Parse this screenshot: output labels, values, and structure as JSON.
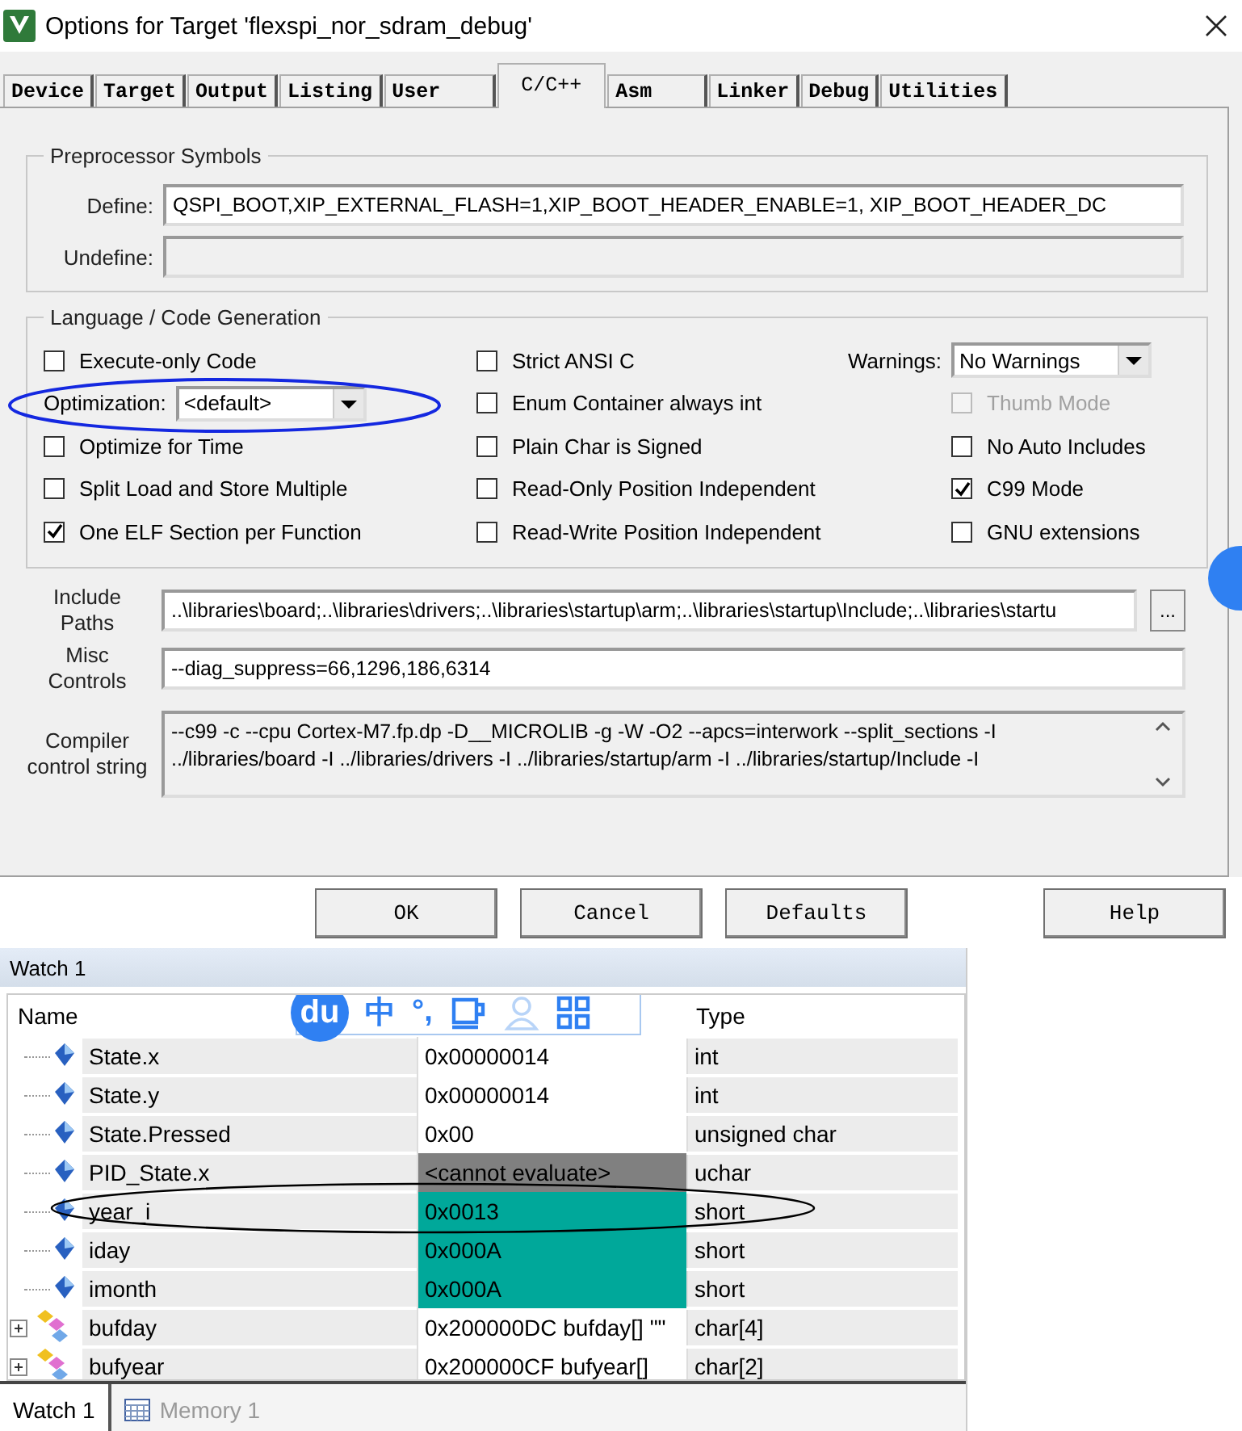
{
  "window": {
    "title": "Options for Target 'flexspi_nor_sdram_debug'"
  },
  "tabs": [
    {
      "label": "Device",
      "selected": false
    },
    {
      "label": "Target",
      "selected": false
    },
    {
      "label": "Output",
      "selected": false
    },
    {
      "label": "Listing",
      "selected": false
    },
    {
      "label": "User",
      "selected": false
    },
    {
      "label": "C/C++",
      "selected": true
    },
    {
      "label": "Asm",
      "selected": false
    },
    {
      "label": "Linker",
      "selected": false
    },
    {
      "label": "Debug",
      "selected": false
    },
    {
      "label": "Utilities",
      "selected": false
    }
  ],
  "preprocessor": {
    "title": "Preprocessor Symbols",
    "define_label": "Define:",
    "define_value": "QSPI_BOOT,XIP_EXTERNAL_FLASH=1,XIP_BOOT_HEADER_ENABLE=1, XIP_BOOT_HEADER_DC",
    "undefine_label": "Undefine:"
  },
  "code_generation": {
    "title": "Language / Code Generation",
    "columns": [
      [
        {
          "kind": "checkbox",
          "label": "Execute-only Code",
          "checked": false,
          "disabled": false
        },
        {
          "kind": "dropdown",
          "label": "Optimization:",
          "value": "<default>"
        },
        {
          "kind": "checkbox",
          "label": "Optimize for Time",
          "checked": false,
          "disabled": false
        },
        {
          "kind": "checkbox",
          "label": "Split Load and Store Multiple",
          "checked": false,
          "disabled": false
        },
        {
          "kind": "checkbox",
          "label": "One ELF Section per Function",
          "checked": true,
          "disabled": false
        }
      ],
      [
        {
          "kind": "checkbox",
          "label": "Strict ANSI C",
          "checked": false,
          "disabled": false
        },
        {
          "kind": "checkbox",
          "label": "Enum Container always int",
          "checked": false,
          "disabled": false
        },
        {
          "kind": "checkbox",
          "label": "Plain Char is Signed",
          "checked": false,
          "disabled": false
        },
        {
          "kind": "checkbox",
          "label": "Read-Only Position Independent",
          "checked": false,
          "disabled": false
        },
        {
          "kind": "checkbox",
          "label": "Read-Write Position Independent",
          "checked": false,
          "disabled": false
        }
      ],
      [
        {
          "kind": "dropdown",
          "label": "Warnings:",
          "value": "No Warnings"
        },
        {
          "kind": "checkbox",
          "label": "Thumb Mode",
          "checked": false,
          "disabled": true
        },
        {
          "kind": "checkbox",
          "label": "No Auto Includes",
          "checked": false,
          "disabled": false
        },
        {
          "kind": "checkbox",
          "label": "C99 Mode",
          "checked": true,
          "disabled": false
        },
        {
          "kind": "checkbox",
          "label": "GNU extensions",
          "checked": false,
          "disabled": false
        }
      ]
    ]
  },
  "include_paths": {
    "label": "Include Paths",
    "value": "..\\libraries\\board;..\\libraries\\drivers;..\\libraries\\startup\\arm;..\\libraries\\startup\\Include;..\\libraries\\startu",
    "browse": "..."
  },
  "misc_controls": {
    "label": "Misc Controls",
    "value": "--diag_suppress=66,1296,186,6314"
  },
  "compiler_string": {
    "label": "Compiler control string",
    "lines": [
      "--c99 -c --cpu Cortex-M7.fp.dp -D__MICROLIB -g -W -O2 --apcs=interwork --split_sections -I",
      "../libraries/board -I ../libraries/drivers -I ../libraries/startup/arm -I ../libraries/startup/Include -I"
    ]
  },
  "buttons": [
    {
      "label": "OK"
    },
    {
      "label": "Cancel"
    },
    {
      "label": "Defaults"
    },
    {
      "label": "Help"
    }
  ],
  "watch": {
    "title": "Watch 1",
    "name_header": "Name",
    "type_header": "Type",
    "rows": [
      {
        "kind": "variable",
        "name": "State.x",
        "value": "0x00000014",
        "type": "int",
        "changed": false,
        "error": false
      },
      {
        "kind": "variable",
        "name": "State.y",
        "value": "0x00000014",
        "type": "int",
        "changed": false,
        "error": false
      },
      {
        "kind": "variable",
        "name": "State.Pressed",
        "value": "0x00",
        "type": "unsigned char",
        "changed": false,
        "error": false
      },
      {
        "kind": "variable",
        "name": "PID_State.x",
        "value": "<cannot evaluate>",
        "type": "uchar",
        "changed": false,
        "error": true
      },
      {
        "kind": "variable",
        "name": "year_i",
        "value": "0x0013",
        "type": "short",
        "changed": true,
        "error": false
      },
      {
        "kind": "variable",
        "name": "iday",
        "value": "0x000A",
        "type": "short",
        "changed": true,
        "error": false
      },
      {
        "kind": "variable",
        "name": "imonth",
        "value": "0x000A",
        "type": "short",
        "changed": true,
        "error": false
      },
      {
        "kind": "array",
        "name": "bufday",
        "value": "0x200000DC bufday[] \"\"",
        "type": "char[4]",
        "changed": false,
        "error": false,
        "expanded": false
      },
      {
        "kind": "array",
        "name": "bufyear",
        "value": "0x200000CF bufyear[]",
        "type": "char[2]",
        "changed": false,
        "error": false,
        "expanded": false
      }
    ],
    "bottom_tabs": [
      {
        "label": "Watch 1",
        "selected": true
      },
      {
        "label": "Memory 1",
        "selected": false
      }
    ]
  },
  "ime_toolbar": {
    "logo": "du",
    "items": [
      "中",
      "°,"
    ]
  },
  "annotations": [
    {
      "kind": "ellipse",
      "color": "#1428e0"
    },
    {
      "kind": "ellipse",
      "color": "#000000"
    }
  ]
}
